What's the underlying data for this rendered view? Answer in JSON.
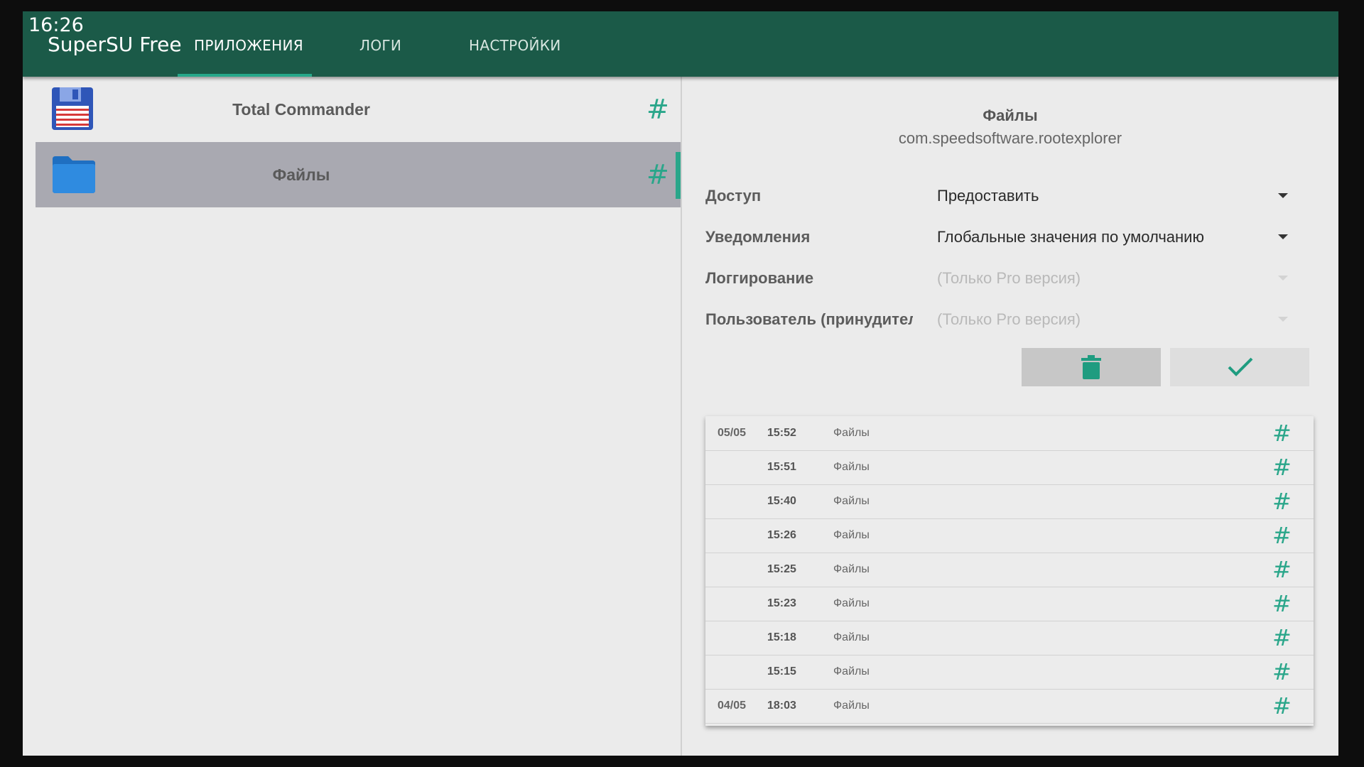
{
  "status_bar": {
    "time": "16:26"
  },
  "header": {
    "app_title": "SuperSU Free",
    "tabs": [
      {
        "label": "ПРИЛОЖЕНИЯ",
        "active": true
      },
      {
        "label": "ЛОГИ",
        "active": false
      },
      {
        "label": "НАСТРОЙКИ",
        "active": false
      }
    ]
  },
  "apps": [
    {
      "name": "Total Commander",
      "icon": "floppy-disk-icon",
      "badge": "#",
      "selected": false
    },
    {
      "name": "Файлы",
      "icon": "folder-icon",
      "badge": "#",
      "selected": true
    }
  ],
  "detail": {
    "name": "Файлы",
    "package": "com.speedsoftware.rootexplorer",
    "options": [
      {
        "label": "Доступ",
        "value": "Предоставить",
        "enabled": true
      },
      {
        "label": "Уведомления",
        "value": "Глобальные значения по умолчанию",
        "enabled": true
      },
      {
        "label": "Логгирование",
        "value": "(Только Pro версия)",
        "enabled": false
      },
      {
        "label": "Пользователь (принудительно)",
        "value": "(Только Pro версия)",
        "enabled": false
      }
    ],
    "delete_icon": "trash-icon",
    "save_icon": "check-icon"
  },
  "logs": [
    {
      "date": "05/05",
      "time": "15:52",
      "app": "Файлы",
      "badge": "#"
    },
    {
      "date": "",
      "time": "15:51",
      "app": "Файлы",
      "badge": "#"
    },
    {
      "date": "",
      "time": "15:40",
      "app": "Файлы",
      "badge": "#"
    },
    {
      "date": "",
      "time": "15:26",
      "app": "Файлы",
      "badge": "#"
    },
    {
      "date": "",
      "time": "15:25",
      "app": "Файлы",
      "badge": "#"
    },
    {
      "date": "",
      "time": "15:23",
      "app": "Файлы",
      "badge": "#"
    },
    {
      "date": "",
      "time": "15:18",
      "app": "Файлы",
      "badge": "#"
    },
    {
      "date": "",
      "time": "15:15",
      "app": "Файлы",
      "badge": "#"
    },
    {
      "date": "04/05",
      "time": "18:03",
      "app": "Файлы",
      "badge": "#"
    }
  ],
  "colors": {
    "header": "#1b5a48",
    "accent": "#2aa68a",
    "selected_row": "#a9a9b1",
    "background": "#ebebeb"
  }
}
